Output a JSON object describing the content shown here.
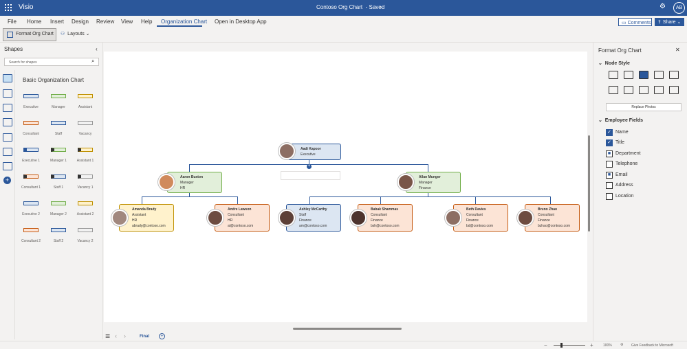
{
  "app": {
    "name": "Visio",
    "document_title": "Contoso Org Chart",
    "save_status": "-  Saved",
    "user_initials": "AB"
  },
  "menu": [
    "File",
    "Home",
    "Insert",
    "Design",
    "Review",
    "View",
    "Help",
    "Organization Chart",
    "Open in Desktop App"
  ],
  "ribbon": {
    "format_org_chart": "Format Org Chart",
    "layouts": "Layouts"
  },
  "header_buttons": {
    "comments": "Comments",
    "share": "Share"
  },
  "shapes_pane": {
    "title": "Shapes",
    "search_placeholder": "Search for shapes",
    "stencil_name": "Basic Organization Chart",
    "shapes": [
      "Executive",
      "Manager",
      "Assistant",
      "Consultant",
      "Staff",
      "Vacancy",
      "Executive 1",
      "Manager 1",
      "Assistant 1",
      "Consultant 1",
      "Staff 1",
      "Vacancy 1",
      "Executive 2",
      "Manager 2",
      "Assistant 2",
      "Consultant 2",
      "Staff 2",
      "Vacancy 2"
    ]
  },
  "org": {
    "exec": {
      "name": "Aadi Kapoor",
      "title": "Executive"
    },
    "mgr1": {
      "name": "Aaron Buxton",
      "title": "Manager",
      "dept": "HR"
    },
    "mgr2": {
      "name": "Allan Munger",
      "title": "Manager",
      "dept": "Finance"
    },
    "p1": {
      "name": "Amanda Brady",
      "title": "Assistant",
      "dept": "HR",
      "email": "abrady@contoso.com"
    },
    "p2": {
      "name": "Andre Lawson",
      "title": "Consultant",
      "dept": "HR",
      "email": "al@contoso.com"
    },
    "p3": {
      "name": "Ashley McCarthy",
      "title": "Staff",
      "dept": "Finance",
      "email": "am@contoso.com"
    },
    "p4": {
      "name": "Babak Shammas",
      "title": "Consultant",
      "dept": "Finance",
      "email": "bsh@contoso.com"
    },
    "p5": {
      "name": "Beth Davies",
      "title": "Consultant",
      "dept": "Finance",
      "email": "bd@contoso.com"
    },
    "p6": {
      "name": "Bruno Zhao",
      "title": "Consultant",
      "dept": "Finance",
      "email": "bzhao@contoso.com"
    }
  },
  "page_tab": "Final",
  "status": {
    "zoom": "100%",
    "feedback": "Give Feedback to Microsoft"
  },
  "right_pane": {
    "title": "Format Org Chart",
    "node_style": "Node Style",
    "replace_photos": "Replace Photos",
    "employee_fields": "Employee Fields",
    "fields": [
      {
        "label": "Name",
        "checked": true
      },
      {
        "label": "Title",
        "checked": true
      },
      {
        "label": "Department",
        "checked": false
      },
      {
        "label": "Telephone",
        "checked": false
      },
      {
        "label": "Email",
        "checked": true
      },
      {
        "label": "Address",
        "checked": false
      },
      {
        "label": "Location",
        "checked": false
      }
    ]
  },
  "colors": {
    "accent": "#2b579a",
    "exec_fill": "#dce6f2",
    "manager_fill": "#e2efda",
    "assistant_fill": "#fff2cc",
    "consultant_fill": "#fce4d6"
  }
}
